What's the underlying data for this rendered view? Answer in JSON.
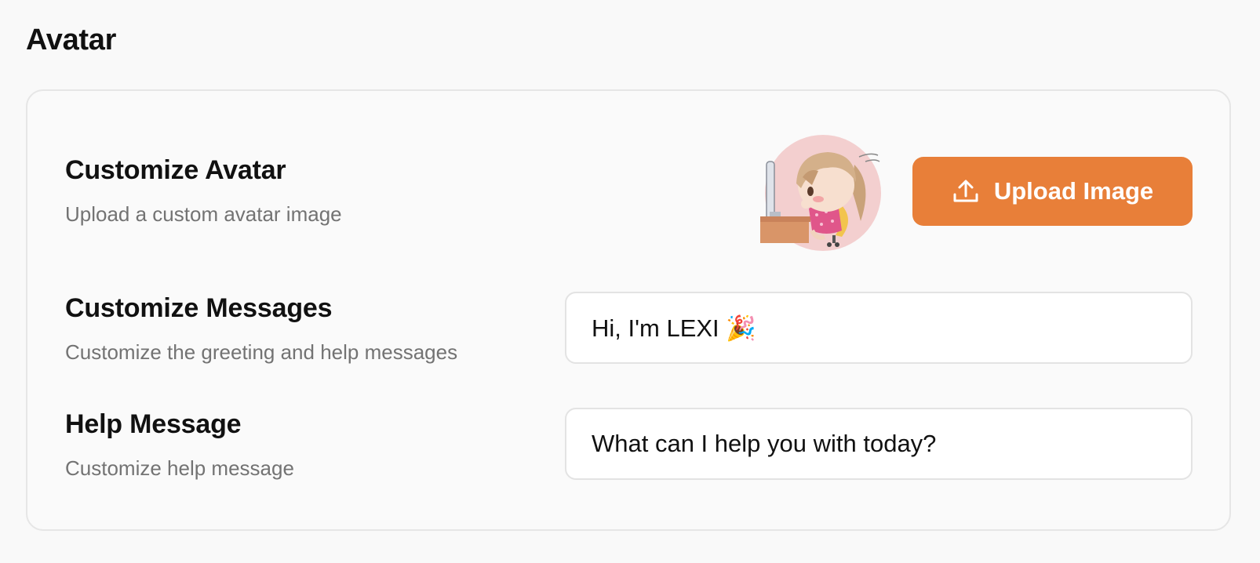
{
  "page": {
    "title": "Avatar"
  },
  "avatar_section": {
    "title": "Customize Avatar",
    "description": "Upload a custom avatar image",
    "upload_button_label": "Upload Image",
    "upload_icon": "upload-icon",
    "avatar_image": "cartoon-girl-at-desk"
  },
  "messages_section": {
    "title": "Customize Messages",
    "description": "Customize the greeting and help messages",
    "greeting_value": "Hi, I'm LEXI 🎉"
  },
  "help_section": {
    "title": "Help Message",
    "description": "Customize help message",
    "help_value": "What can I help you with today?"
  },
  "colors": {
    "accent": "#e87f39",
    "background": "#f9f9f9",
    "muted_text": "#737373"
  }
}
